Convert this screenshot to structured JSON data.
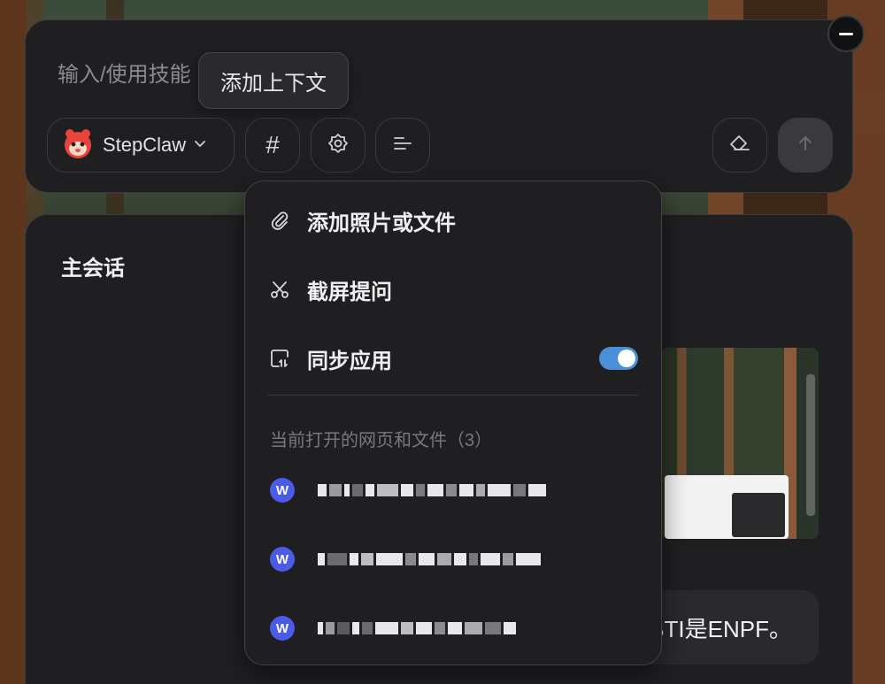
{
  "input": {
    "placeholder": "输入/使用技能",
    "tooltip": "添加上下文",
    "agent_label": "StepClaw"
  },
  "toolbar": {
    "hash_label": "#"
  },
  "session": {
    "title": "主会话",
    "message_tail": "BTI是ENPF。"
  },
  "dropdown": {
    "items": [
      {
        "label": "添加照片或文件",
        "icon": "paperclip-icon"
      },
      {
        "label": "截屏提问",
        "icon": "scissors-icon"
      },
      {
        "label": "同步应用",
        "icon": "sync-app-icon",
        "toggle_on": true
      }
    ],
    "section_label": "当前打开的网页和文件（3）",
    "files": [
      {
        "badge": "W"
      },
      {
        "badge": "W"
      },
      {
        "badge": "W"
      }
    ]
  },
  "colors": {
    "panel_bg": "#1f1f22",
    "toggle_on": "#4a90d9",
    "file_badge": "#4a5be6"
  }
}
